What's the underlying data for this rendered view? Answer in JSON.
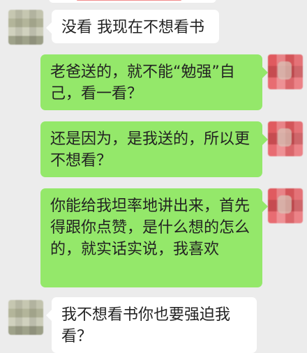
{
  "messages": [
    {
      "side": "left",
      "text": "没看 我现在不想看书"
    },
    {
      "side": "right",
      "text": "老爸送的，就不能“勉强”自己，看一看？"
    },
    {
      "side": "right",
      "text": "还是因为，是我送的，所以更不想看？"
    },
    {
      "side": "right",
      "text": "你能给我坦率地讲出来，首先得跟你点赞，是什么想的怎么的，就实话实说，我喜欢"
    },
    {
      "side": "left",
      "text": "我不想看书你也要强迫我看？"
    }
  ]
}
